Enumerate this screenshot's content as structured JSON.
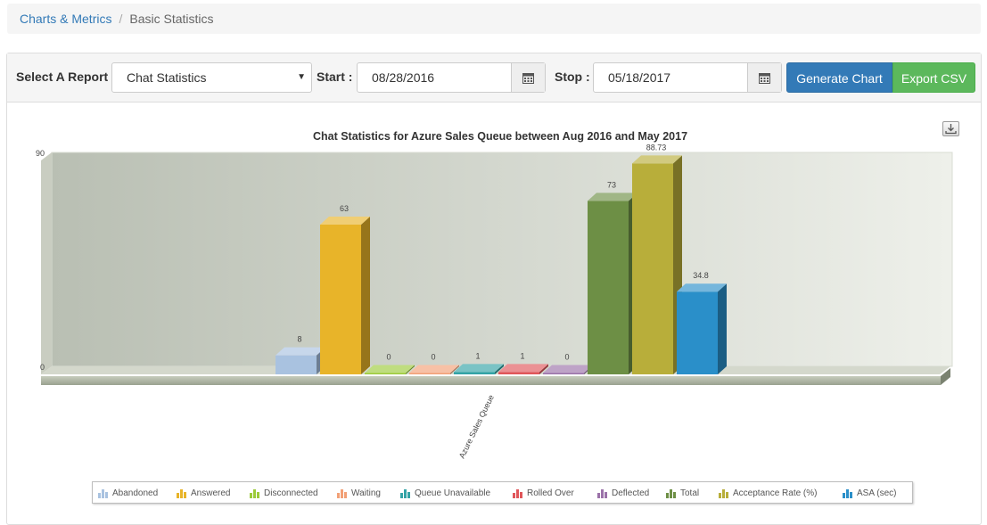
{
  "breadcrumb": {
    "link": "Charts & Metrics",
    "separator": "/",
    "current": "Basic Statistics"
  },
  "form": {
    "report_label": "Select A Report",
    "report_value": "Chat Statistics",
    "start_label": "Start",
    "start_value": "08/28/2016",
    "stop_label": "Stop",
    "stop_value": "05/18/2017",
    "colon": ":",
    "generate_label": "Generate Chart",
    "export_label": "Export CSV"
  },
  "icons": {
    "calendar": "calendar-icon",
    "download": "download-icon",
    "caret": "caret-down-icon"
  },
  "colors": {
    "primary": "#337ab7",
    "success": "#5cb85c"
  },
  "chart_data": {
    "type": "bar",
    "title": "Chat Statistics for Azure Sales Queue between Aug 2016 and May 2017",
    "categories": [
      "Azure Sales Queue"
    ],
    "ylim": [
      0,
      90
    ],
    "y_ticks": [
      "0",
      "90"
    ],
    "grid": false,
    "legend_position": "bottom",
    "series": [
      {
        "name": "Abandoned",
        "values": [
          8
        ],
        "label": "8",
        "color": "#a9c2e0"
      },
      {
        "name": "Answered",
        "values": [
          63
        ],
        "label": "63",
        "color": "#e8b429"
      },
      {
        "name": "Disconnected",
        "values": [
          0
        ],
        "label": "0",
        "color": "#9ccb3a"
      },
      {
        "name": "Waiting",
        "values": [
          0
        ],
        "label": "0",
        "color": "#f2a076"
      },
      {
        "name": "Queue Unavailable",
        "values": [
          1
        ],
        "label": "1",
        "color": "#33a3a6"
      },
      {
        "name": "Rolled Over",
        "values": [
          1
        ],
        "label": "1",
        "color": "#e0565a"
      },
      {
        "name": "Deflected",
        "values": [
          0
        ],
        "label": "0",
        "color": "#9b72a9"
      },
      {
        "name": "Total",
        "values": [
          73
        ],
        "label": "73",
        "color": "#6d8f45"
      },
      {
        "name": "Acceptance Rate (%)",
        "values": [
          88.73
        ],
        "label": "88.73",
        "color": "#b8ae3a"
      },
      {
        "name": "ASA (sec)",
        "values": [
          34.8
        ],
        "label": "34.8",
        "color": "#2a8fc9"
      }
    ]
  }
}
